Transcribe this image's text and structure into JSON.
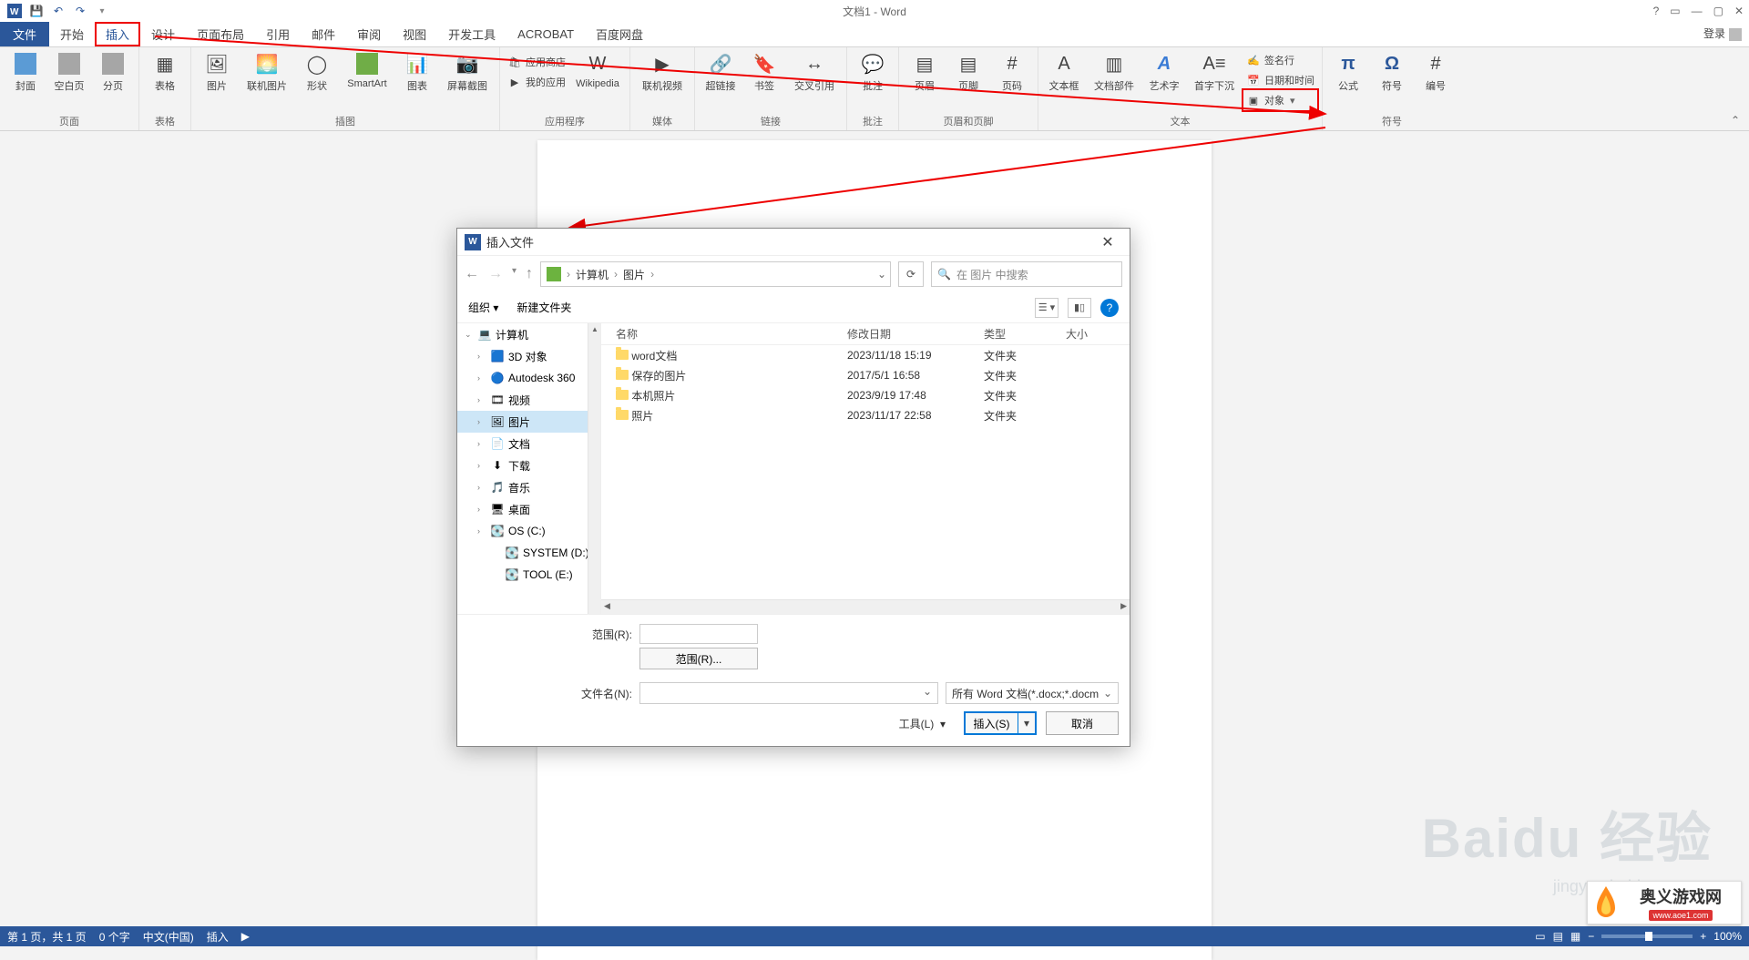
{
  "title": "文档1 - Word",
  "login": "登录",
  "tabs": {
    "file": "文件",
    "items": [
      "开始",
      "插入",
      "设计",
      "页面布局",
      "引用",
      "邮件",
      "审阅",
      "视图",
      "开发工具",
      "ACROBAT",
      "百度网盘"
    ],
    "activeIndex": 1
  },
  "ribbon": {
    "groups": [
      {
        "label": "页面",
        "buttons": [
          "封面",
          "空白页",
          "分页"
        ]
      },
      {
        "label": "表格",
        "buttons": [
          "表格"
        ]
      },
      {
        "label": "插图",
        "buttons": [
          "图片",
          "联机图片",
          "形状",
          "SmartArt",
          "图表",
          "屏幕截图"
        ]
      },
      {
        "label": "应用程序",
        "small": [
          "应用商店",
          "我的应用"
        ],
        "buttons": [
          "Wikipedia"
        ]
      },
      {
        "label": "媒体",
        "buttons": [
          "联机视频"
        ]
      },
      {
        "label": "链接",
        "buttons": [
          "超链接",
          "书签",
          "交叉引用"
        ]
      },
      {
        "label": "批注",
        "buttons": [
          "批注"
        ]
      },
      {
        "label": "页眉和页脚",
        "buttons": [
          "页眉",
          "页脚",
          "页码"
        ]
      },
      {
        "label": "文本",
        "buttons": [
          "文本框",
          "文档部件",
          "艺术字",
          "首字下沉"
        ],
        "small": [
          "签名行",
          "日期和时间",
          "对象"
        ]
      },
      {
        "label": "符号",
        "buttons": [
          "公式",
          "符号",
          "编号"
        ]
      }
    ]
  },
  "dialog": {
    "title": "插入文件",
    "back": "←",
    "fwd": "→",
    "up": "↑",
    "breadcrumb": [
      "计算机",
      "图片"
    ],
    "search_placeholder": "在 图片 中搜索",
    "toolbar": {
      "organize": "组织",
      "newfolder": "新建文件夹"
    },
    "tree": [
      {
        "d": 0,
        "label": "计算机",
        "chev": "⌄",
        "icon": "💻"
      },
      {
        "d": 1,
        "label": "3D 对象",
        "chev": "›",
        "icon": "🟦"
      },
      {
        "d": 1,
        "label": "Autodesk 360",
        "chev": "›",
        "icon": "🔵"
      },
      {
        "d": 1,
        "label": "视频",
        "chev": "›",
        "icon": "🎞"
      },
      {
        "d": 1,
        "label": "图片",
        "chev": "›",
        "icon": "🖼",
        "sel": true
      },
      {
        "d": 1,
        "label": "文档",
        "chev": "›",
        "icon": "📄"
      },
      {
        "d": 1,
        "label": "下载",
        "chev": "›",
        "icon": "⬇"
      },
      {
        "d": 1,
        "label": "音乐",
        "chev": "›",
        "icon": "🎵"
      },
      {
        "d": 1,
        "label": "桌面",
        "chev": "›",
        "icon": "🖥"
      },
      {
        "d": 1,
        "label": "OS (C:)",
        "chev": "›",
        "icon": "💽"
      },
      {
        "d": 2,
        "label": "SYSTEM (D:)",
        "chev": "",
        "icon": "💽"
      },
      {
        "d": 2,
        "label": "TOOL (E:)",
        "chev": "",
        "icon": "💽"
      }
    ],
    "columns": {
      "name": "名称",
      "date": "修改日期",
      "type": "类型",
      "size": "大小"
    },
    "rows": [
      {
        "name": "word文档",
        "date": "2023/11/18 15:19",
        "type": "文件夹"
      },
      {
        "name": "保存的图片",
        "date": "2017/5/1 16:58",
        "type": "文件夹"
      },
      {
        "name": "本机照片",
        "date": "2023/9/19 17:48",
        "type": "文件夹"
      },
      {
        "name": "照片",
        "date": "2023/11/17 22:58",
        "type": "文件夹"
      }
    ],
    "range_label": "范围(R):",
    "range_button": "范围(R)...",
    "filename_label": "文件名(N):",
    "filter": "所有 Word 文档(*.docx;*.docm",
    "tools": "工具(L)",
    "insert": "插入(S)",
    "cancel": "取消"
  },
  "status": {
    "page": "第 1 页，共 1 页",
    "words": "0 个字",
    "lang": "中文(中国)",
    "mode": "插入",
    "zoom": "100%"
  },
  "watermark": {
    "baidu": "Baidu 经验",
    "baidu_url": "jingyan.baidu.com",
    "logo_text": "奥义游戏网",
    "logo_url": "www.aoe1.com"
  }
}
